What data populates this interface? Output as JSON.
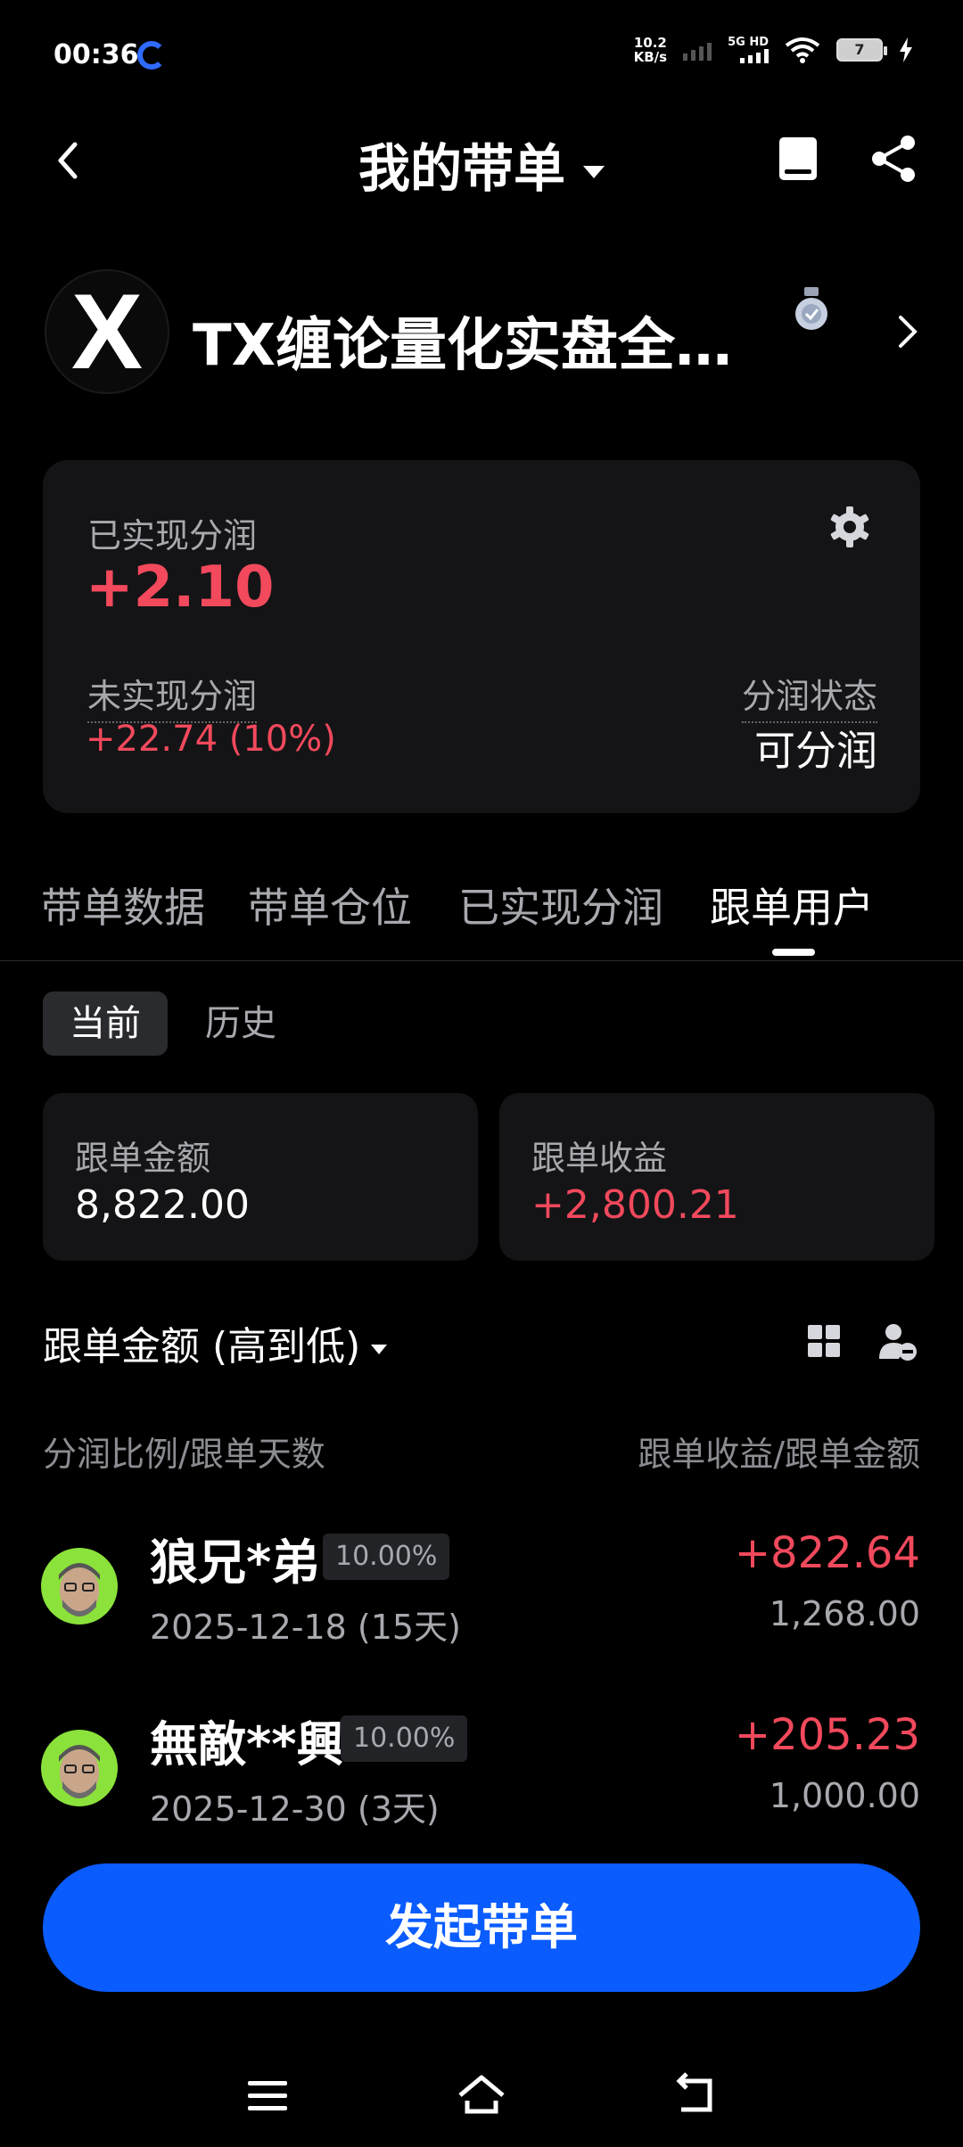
{
  "status_bar": {
    "time": "00:36",
    "net_speed_value": "10.2",
    "net_speed_unit": "KB/s",
    "network": "5G HD",
    "battery": "7"
  },
  "header": {
    "title": "我的带单"
  },
  "profile": {
    "logo_text": "X",
    "name": "TX缠论量化实盘全…"
  },
  "summary": {
    "realized_label": "已实现分润",
    "realized_value": "+2.10",
    "unrealized_label": "未实现分润",
    "unrealized_value": "+22.74 (10%)",
    "status_label": "分润状态",
    "status_value": "可分润"
  },
  "tabs": [
    {
      "label": "带单数据"
    },
    {
      "label": "带单仓位"
    },
    {
      "label": "已实现分润"
    },
    {
      "label": "跟单用户"
    }
  ],
  "segments": {
    "current": "当前",
    "history": "历史"
  },
  "stats": {
    "amount_label": "跟单金额",
    "amount_value": "8,822.00",
    "profit_label": "跟单收益",
    "profit_value": "+2,800.21"
  },
  "sort": {
    "label": "跟单金额 (高到低)"
  },
  "columns": {
    "left": "分润比例/跟单天数",
    "right": "跟单收益/跟单金额"
  },
  "users": [
    {
      "name": "狼兄*弟",
      "ratio": "10.00%",
      "date": "2025-12-18 (15天)",
      "profit": "+822.64",
      "amount": "1,268.00"
    },
    {
      "name": "無敵**興",
      "ratio": "10.00%",
      "date": "2025-12-30 (3天)",
      "profit": "+205.23",
      "amount": "1,000.00"
    }
  ],
  "cta": {
    "label": "发起带单"
  },
  "colors": {
    "accent_blue": "#0a5cff",
    "profit_red": "#f2495c",
    "card_bg": "#141416"
  }
}
